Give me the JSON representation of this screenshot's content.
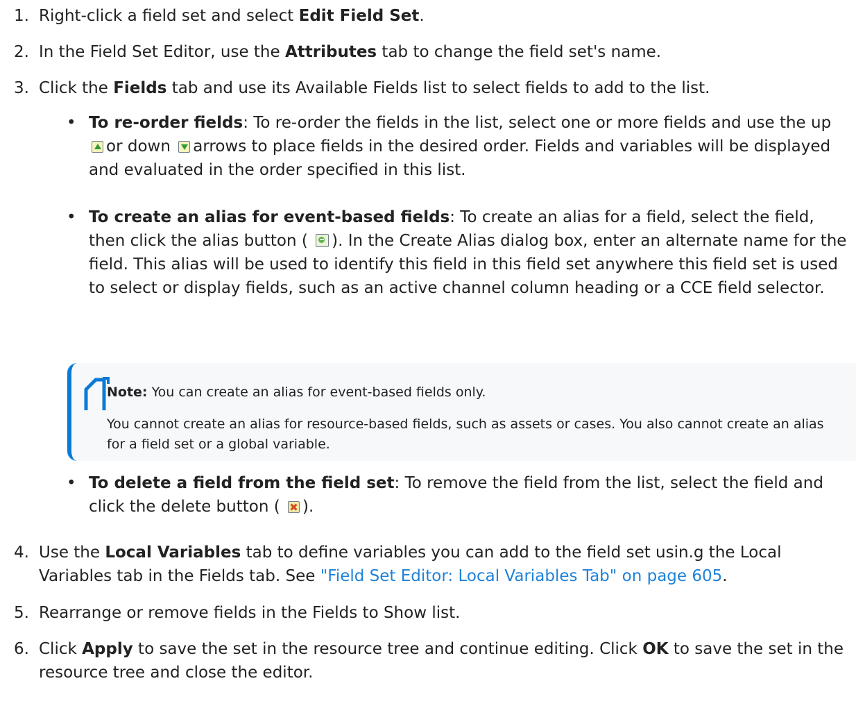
{
  "steps": [
    {
      "num": "1.",
      "pre": "Right-click a field set and select ",
      "bold": "Edit Field Set",
      "post": "."
    },
    {
      "num": "2.",
      "pre": "In the Field Set Editor, use the ",
      "bold": "Attributes",
      "post": " tab to change the field set's name."
    },
    {
      "num": "3.",
      "pre": "Click the ",
      "bold": "Fields",
      "post": " tab and use its Available Fields list to select fields to add to the list."
    },
    {
      "num": "4.",
      "pre": "Use the ",
      "bold": "Local Variables",
      "post": " tab to define variables you can add to the field set usin.g the Local Variables tab in the Fields tab. See ",
      "link": "\"Field Set Editor: Local Variables Tab\" on page 605",
      "post2": "."
    },
    {
      "num": "5.",
      "text": "Rearrange or remove fields in the Fields to Show list."
    },
    {
      "num": "6.",
      "pre": "Click ",
      "bold": "Apply",
      "mid": " to save the set in the resource tree and continue editing. Click ",
      "bold2": "OK",
      "post": " to save the set in the resource tree and close the editor."
    }
  ],
  "bullets": {
    "reorder": {
      "dot": "•",
      "title": "To re-order fields",
      "text_a": ": To re-order the fields in the list, select one or more fields and use the up",
      "text_b": "or down",
      "text_c": "arrows to place fields in the desired order. Fields and variables will be displayed and evaluated in the order specified in this list."
    },
    "alias": {
      "dot": "•",
      "title": "To create an alias for event-based fields",
      "text_a": ": To create an alias for a field, select the field, then click the alias button (",
      "text_b": "). In the Create Alias dialog box, enter an alternate name for the field. This alias will be used to identify this field in this field set anywhere this field set is used to select or display fields, such as an active channel column heading or a CCE field selector."
    },
    "delete": {
      "dot": "•",
      "title": "To delete a field from the field set",
      "text_a": ": To remove the field from the list, select the field and click the delete button (",
      "text_b": ")."
    }
  },
  "note": {
    "label": "Note:",
    "line1": " You can create an alias for event-based fields only.",
    "line2": "You cannot create an alias for resource-based fields, such as assets or cases. You also cannot create an alias for a field set or a global variable."
  },
  "colors": {
    "link": "#1f82d9",
    "note_border": "#0a7ad6",
    "note_bg": "#f7f8fa"
  },
  "icons": [
    "up-arrow-icon",
    "down-arrow-icon",
    "alias-icon",
    "delete-icon",
    "note-icon"
  ]
}
